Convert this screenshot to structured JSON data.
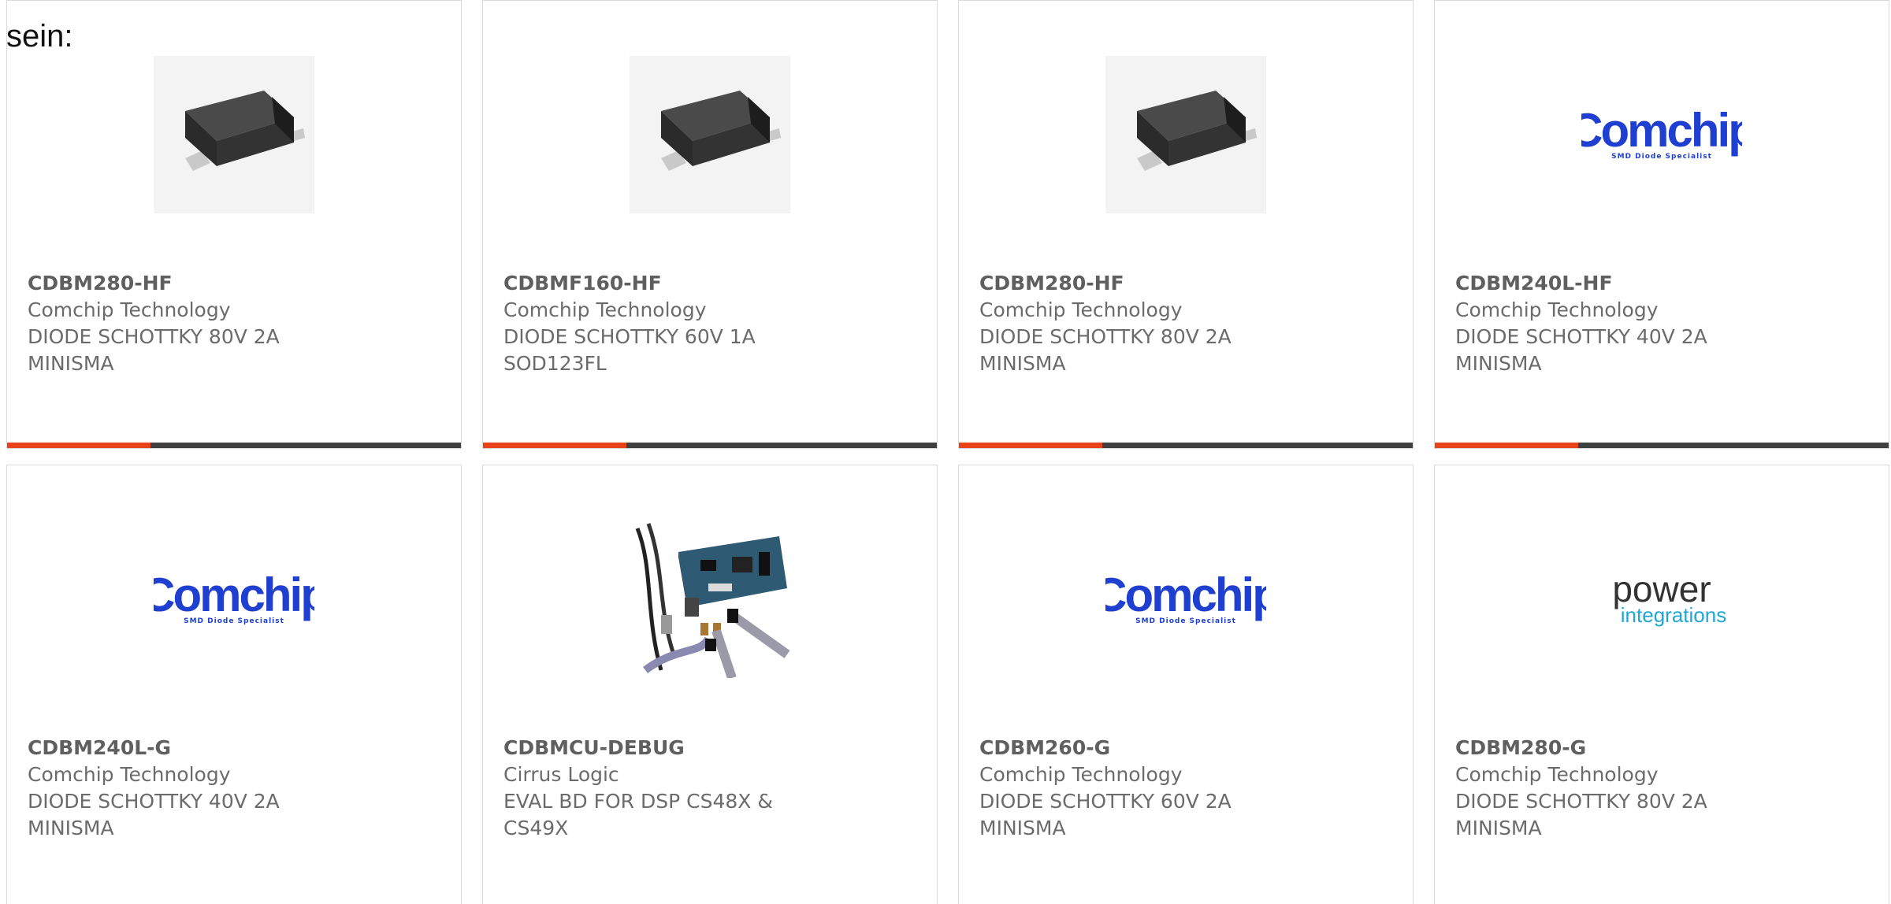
{
  "intro_text": "sein:",
  "colors": {
    "accent": "#e8431b",
    "bar": "#404040",
    "comchip_blue": "#1f3fd0",
    "power_blue": "#1ea6d8"
  },
  "products": [
    {
      "part_number": "CDBM280-HF",
      "manufacturer": "Comchip Technology",
      "description": "DIODE SCHOTTKY 80V 2A MINISMA",
      "image": "smd-diode-image"
    },
    {
      "part_number": "CDBMF160-HF",
      "manufacturer": "Comchip Technology",
      "description": "DIODE SCHOTTKY 60V 1A SOD123FL",
      "image": "smd-diode-image"
    },
    {
      "part_number": "CDBM280-HF",
      "manufacturer": "Comchip Technology",
      "description": "DIODE SCHOTTKY 80V 2A MINISMA",
      "image": "smd-diode-image"
    },
    {
      "part_number": "CDBM240L-HF",
      "manufacturer": "Comchip Technology",
      "description": "DIODE SCHOTTKY 40V 2A MINISMA",
      "image": "comchip-logo",
      "logo_text": "Comchip",
      "logo_subtext": "SMD Diode Specialist"
    },
    {
      "part_number": "CDBM240L-G",
      "manufacturer": "Comchip Technology",
      "description": "DIODE SCHOTTKY 40V 2A MINISMA",
      "image": "comchip-logo",
      "logo_text": "Comchip",
      "logo_subtext": "SMD Diode Specialist"
    },
    {
      "part_number": "CDBMCU-DEBUG",
      "manufacturer": "Cirrus Logic",
      "description": "EVAL BD FOR DSP CS48X & CS49X",
      "image": "eval-board-image"
    },
    {
      "part_number": "CDBM260-G",
      "manufacturer": "Comchip Technology",
      "description": "DIODE SCHOTTKY 60V 2A MINISMA",
      "image": "comchip-logo",
      "logo_text": "Comchip",
      "logo_subtext": "SMD Diode Specialist"
    },
    {
      "part_number": "CDBM280-G",
      "manufacturer": "Comchip Technology",
      "description": "DIODE SCHOTTKY 80V 2A MINISMA",
      "image": "power-integrations-logo",
      "logo_text": "power",
      "logo_subtext": "integrations"
    }
  ]
}
